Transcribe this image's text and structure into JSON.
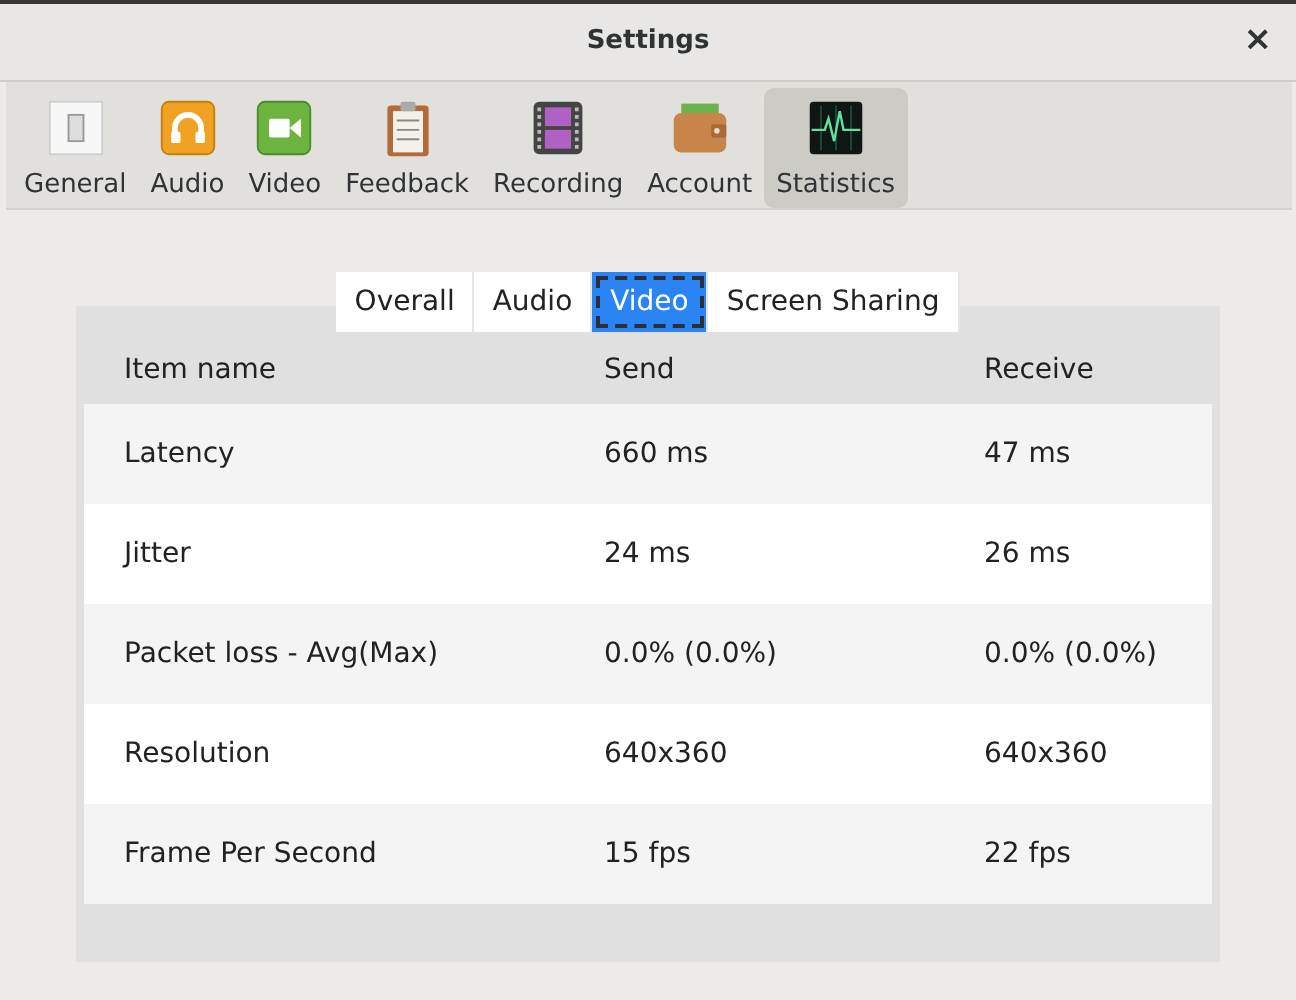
{
  "window": {
    "title": "Settings",
    "close": "×"
  },
  "toolbar": [
    {
      "label": "General",
      "selected": false
    },
    {
      "label": "Audio",
      "selected": false
    },
    {
      "label": "Video",
      "selected": false
    },
    {
      "label": "Feedback",
      "selected": false
    },
    {
      "label": "Recording",
      "selected": false
    },
    {
      "label": "Account",
      "selected": false
    },
    {
      "label": "Statistics",
      "selected": true
    }
  ],
  "tabs": [
    {
      "label": "Overall",
      "selected": false
    },
    {
      "label": "Audio",
      "selected": false
    },
    {
      "label": "Video",
      "selected": true
    },
    {
      "label": "Screen Sharing",
      "selected": false
    }
  ],
  "table": {
    "columns": [
      "Item name",
      "Send",
      "Receive"
    ],
    "rows": [
      [
        "Latency",
        "660 ms",
        "47 ms"
      ],
      [
        "Jitter",
        "24 ms",
        "26 ms"
      ],
      [
        "Packet loss - Avg(Max)",
        "0.0% (0.0%)",
        "0.0% (0.0%)"
      ],
      [
        "Resolution",
        "640x360",
        "640x360"
      ],
      [
        "Frame Per Second",
        "15 fps",
        "22 fps"
      ]
    ]
  }
}
